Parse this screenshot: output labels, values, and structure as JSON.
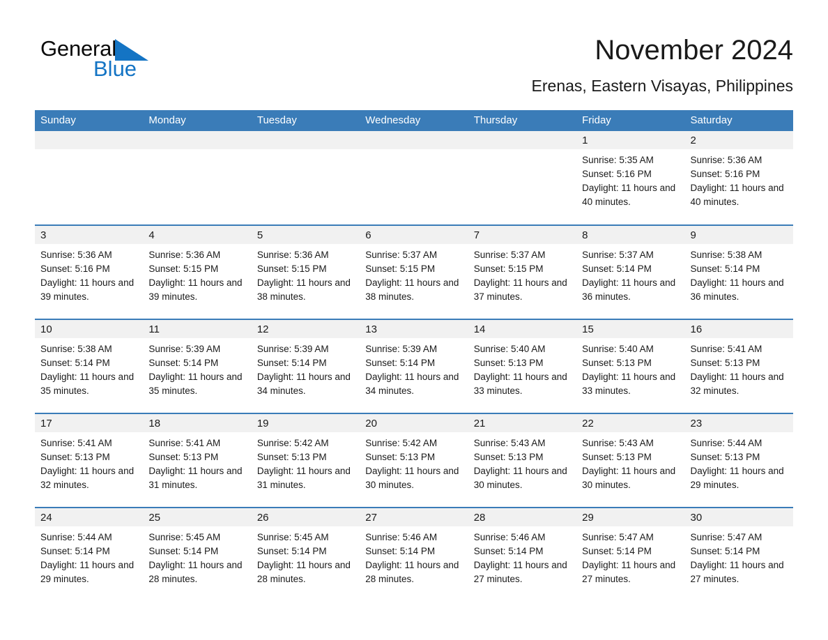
{
  "logo": {
    "word_black": "General",
    "word_blue": "Blue",
    "triangle_icon": "triangle-icon",
    "brand_blue": "#1474c4"
  },
  "header": {
    "title": "November 2024",
    "subtitle": "Erenas, Eastern Visayas, Philippines"
  },
  "theme": {
    "header_blue": "#3a7cb8",
    "daynum_strip_gray": "#f1f1f1",
    "text_dark": "#1a1a1a"
  },
  "weekdays": [
    "Sunday",
    "Monday",
    "Tuesday",
    "Wednesday",
    "Thursday",
    "Friday",
    "Saturday"
  ],
  "labels": {
    "sunrise_prefix": "Sunrise: ",
    "sunset_prefix": "Sunset: ",
    "daylight_prefix": "Daylight: "
  },
  "weeks": [
    [
      {
        "day": "",
        "empty": true
      },
      {
        "day": "",
        "empty": true
      },
      {
        "day": "",
        "empty": true
      },
      {
        "day": "",
        "empty": true
      },
      {
        "day": "",
        "empty": true
      },
      {
        "day": "1",
        "sunrise": "Sunrise: 5:35 AM",
        "sunset": "Sunset: 5:16 PM",
        "daylight": "Daylight: 11 hours and 40 minutes."
      },
      {
        "day": "2",
        "sunrise": "Sunrise: 5:36 AM",
        "sunset": "Sunset: 5:16 PM",
        "daylight": "Daylight: 11 hours and 40 minutes."
      }
    ],
    [
      {
        "day": "3",
        "sunrise": "Sunrise: 5:36 AM",
        "sunset": "Sunset: 5:16 PM",
        "daylight": "Daylight: 11 hours and 39 minutes."
      },
      {
        "day": "4",
        "sunrise": "Sunrise: 5:36 AM",
        "sunset": "Sunset: 5:15 PM",
        "daylight": "Daylight: 11 hours and 39 minutes."
      },
      {
        "day": "5",
        "sunrise": "Sunrise: 5:36 AM",
        "sunset": "Sunset: 5:15 PM",
        "daylight": "Daylight: 11 hours and 38 minutes."
      },
      {
        "day": "6",
        "sunrise": "Sunrise: 5:37 AM",
        "sunset": "Sunset: 5:15 PM",
        "daylight": "Daylight: 11 hours and 38 minutes."
      },
      {
        "day": "7",
        "sunrise": "Sunrise: 5:37 AM",
        "sunset": "Sunset: 5:15 PM",
        "daylight": "Daylight: 11 hours and 37 minutes."
      },
      {
        "day": "8",
        "sunrise": "Sunrise: 5:37 AM",
        "sunset": "Sunset: 5:14 PM",
        "daylight": "Daylight: 11 hours and 36 minutes."
      },
      {
        "day": "9",
        "sunrise": "Sunrise: 5:38 AM",
        "sunset": "Sunset: 5:14 PM",
        "daylight": "Daylight: 11 hours and 36 minutes."
      }
    ],
    [
      {
        "day": "10",
        "sunrise": "Sunrise: 5:38 AM",
        "sunset": "Sunset: 5:14 PM",
        "daylight": "Daylight: 11 hours and 35 minutes."
      },
      {
        "day": "11",
        "sunrise": "Sunrise: 5:39 AM",
        "sunset": "Sunset: 5:14 PM",
        "daylight": "Daylight: 11 hours and 35 minutes."
      },
      {
        "day": "12",
        "sunrise": "Sunrise: 5:39 AM",
        "sunset": "Sunset: 5:14 PM",
        "daylight": "Daylight: 11 hours and 34 minutes."
      },
      {
        "day": "13",
        "sunrise": "Sunrise: 5:39 AM",
        "sunset": "Sunset: 5:14 PM",
        "daylight": "Daylight: 11 hours and 34 minutes."
      },
      {
        "day": "14",
        "sunrise": "Sunrise: 5:40 AM",
        "sunset": "Sunset: 5:13 PM",
        "daylight": "Daylight: 11 hours and 33 minutes."
      },
      {
        "day": "15",
        "sunrise": "Sunrise: 5:40 AM",
        "sunset": "Sunset: 5:13 PM",
        "daylight": "Daylight: 11 hours and 33 minutes."
      },
      {
        "day": "16",
        "sunrise": "Sunrise: 5:41 AM",
        "sunset": "Sunset: 5:13 PM",
        "daylight": "Daylight: 11 hours and 32 minutes."
      }
    ],
    [
      {
        "day": "17",
        "sunrise": "Sunrise: 5:41 AM",
        "sunset": "Sunset: 5:13 PM",
        "daylight": "Daylight: 11 hours and 32 minutes."
      },
      {
        "day": "18",
        "sunrise": "Sunrise: 5:41 AM",
        "sunset": "Sunset: 5:13 PM",
        "daylight": "Daylight: 11 hours and 31 minutes."
      },
      {
        "day": "19",
        "sunrise": "Sunrise: 5:42 AM",
        "sunset": "Sunset: 5:13 PM",
        "daylight": "Daylight: 11 hours and 31 minutes."
      },
      {
        "day": "20",
        "sunrise": "Sunrise: 5:42 AM",
        "sunset": "Sunset: 5:13 PM",
        "daylight": "Daylight: 11 hours and 30 minutes."
      },
      {
        "day": "21",
        "sunrise": "Sunrise: 5:43 AM",
        "sunset": "Sunset: 5:13 PM",
        "daylight": "Daylight: 11 hours and 30 minutes."
      },
      {
        "day": "22",
        "sunrise": "Sunrise: 5:43 AM",
        "sunset": "Sunset: 5:13 PM",
        "daylight": "Daylight: 11 hours and 30 minutes."
      },
      {
        "day": "23",
        "sunrise": "Sunrise: 5:44 AM",
        "sunset": "Sunset: 5:13 PM",
        "daylight": "Daylight: 11 hours and 29 minutes."
      }
    ],
    [
      {
        "day": "24",
        "sunrise": "Sunrise: 5:44 AM",
        "sunset": "Sunset: 5:14 PM",
        "daylight": "Daylight: 11 hours and 29 minutes."
      },
      {
        "day": "25",
        "sunrise": "Sunrise: 5:45 AM",
        "sunset": "Sunset: 5:14 PM",
        "daylight": "Daylight: 11 hours and 28 minutes."
      },
      {
        "day": "26",
        "sunrise": "Sunrise: 5:45 AM",
        "sunset": "Sunset: 5:14 PM",
        "daylight": "Daylight: 11 hours and 28 minutes."
      },
      {
        "day": "27",
        "sunrise": "Sunrise: 5:46 AM",
        "sunset": "Sunset: 5:14 PM",
        "daylight": "Daylight: 11 hours and 28 minutes."
      },
      {
        "day": "28",
        "sunrise": "Sunrise: 5:46 AM",
        "sunset": "Sunset: 5:14 PM",
        "daylight": "Daylight: 11 hours and 27 minutes."
      },
      {
        "day": "29",
        "sunrise": "Sunrise: 5:47 AM",
        "sunset": "Sunset: 5:14 PM",
        "daylight": "Daylight: 11 hours and 27 minutes."
      },
      {
        "day": "30",
        "sunrise": "Sunrise: 5:47 AM",
        "sunset": "Sunset: 5:14 PM",
        "daylight": "Daylight: 11 hours and 27 minutes."
      }
    ]
  ]
}
